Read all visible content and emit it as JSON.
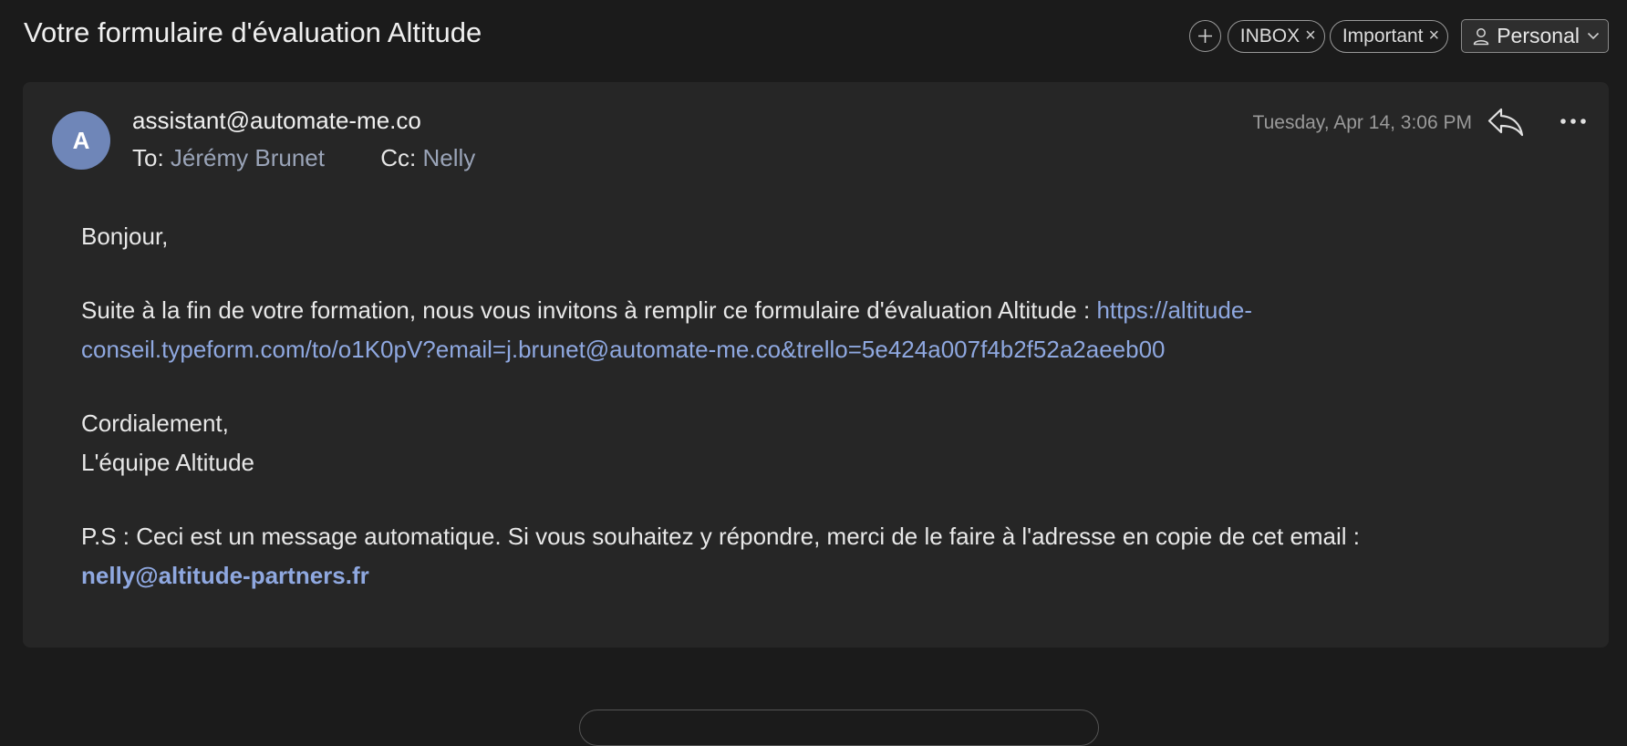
{
  "header": {
    "subject": "Votre formulaire d'évaluation Altitude",
    "labels": [
      {
        "name": "INBOX"
      },
      {
        "name": "Important"
      }
    ],
    "remove_glyph": "×",
    "account": "Personal"
  },
  "message": {
    "avatar_initial": "A",
    "sender": "assistant@automate-me.co",
    "to_label": "To:",
    "to": "Jérémy Brunet",
    "cc_label": "Cc:",
    "cc": "Nelly",
    "date": "Tuesday, Apr 14, 3:06 PM",
    "body": {
      "greeting": "Bonjour,",
      "intro": "Suite à la fin de votre formation, nous vous invitons à remplir ce formulaire d'évaluation Altitude : ",
      "link": "https://altitude-conseil.typeform.com/to/o1K0pV?email=j.brunet@automate-me.co&trello=5e424a007f4b2f52a2aeeb00",
      "closing": "Cordialement,",
      "signature": "L'équipe Altitude",
      "ps": "P.S : Ceci est un message automatique. Si vous souhaitez y répondre, merci de le faire à l'adresse en copie de cet email : ",
      "ps_email": "nelly@altitude-partners.fr"
    }
  },
  "colors": {
    "background": "#1b1b1b",
    "card": "#262626",
    "avatar": "#6f86b8",
    "link": "#8fa8e0"
  },
  "icons": [
    "add-label-icon",
    "remove-icon",
    "person-icon",
    "chevron-down-icon",
    "reply-icon",
    "more-icon"
  ]
}
